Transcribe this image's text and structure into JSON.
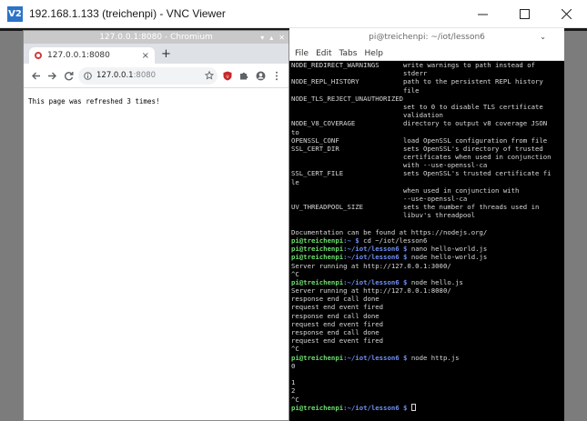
{
  "vnc": {
    "title": "192.168.1.133 (treichenpi) - VNC Viewer",
    "logo_text": "V2"
  },
  "chromium": {
    "window_title": "127.0.0.1:8080 - Chromium",
    "wm_buttons": [
      "▾",
      "▴",
      "✕"
    ],
    "tab_title": "127.0.0.1:8080",
    "tab_close": "×",
    "new_tab": "+",
    "url_host": "127.0.0.1",
    "url_port": ":8080",
    "page_text": "This page was refreshed 3 times!"
  },
  "terminal": {
    "window_title": "pi@treichenpi: ~/iot/lesson6",
    "chevron": "⌄",
    "menu": [
      "File",
      "Edit",
      "Tabs",
      "Help"
    ],
    "lines": [
      {
        "t": "NODE_REDIRECT_WARNINGS      write warnings to path instead of"
      },
      {
        "t": "                            stderr"
      },
      {
        "t": "NODE_REPL_HISTORY           path to the persistent REPL history"
      },
      {
        "t": "                            file"
      },
      {
        "t": "NODE_TLS_REJECT_UNAUTHORIZED"
      },
      {
        "t": "                            set to 0 to disable TLS certificate"
      },
      {
        "t": "                            validation"
      },
      {
        "t": "NODE_V8_COVERAGE            directory to output v8 coverage JSON"
      },
      {
        "t": "to"
      },
      {
        "t": "OPENSSL_CONF                load OpenSSL configuration from file"
      },
      {
        "t": "SSL_CERT_DIR                sets OpenSSL's directory of trusted"
      },
      {
        "t": "                            certificates when used in conjunction"
      },
      {
        "t": "                            with --use-openssl-ca"
      },
      {
        "t": "SSL_CERT_FILE               sets OpenSSL's trusted certificate fi"
      },
      {
        "t": "le"
      },
      {
        "t": "                            when used in conjunction with"
      },
      {
        "t": "                            --use-openssl-ca"
      },
      {
        "t": "UV_THREADPOOL_SIZE          sets the number of threads used in"
      },
      {
        "t": "                            libuv's threadpool"
      },
      {
        "t": ""
      },
      {
        "t": "Documentation can be found at https://nodejs.org/"
      },
      {
        "u": "pi@treichenpi",
        "p": ":~ $",
        "c": " cd ~/iot/lesson6"
      },
      {
        "u": "pi@treichenpi",
        "p": ":~/iot/lesson6 $",
        "c": " nano hello-world.js"
      },
      {
        "u": "pi@treichenpi",
        "p": ":~/iot/lesson6 $",
        "c": " node hello-world.js"
      },
      {
        "t": "Server running at http://127.0.0.1:3000/"
      },
      {
        "t": "^C"
      },
      {
        "u": "pi@treichenpi",
        "p": ":~/iot/lesson6 $",
        "c": " node hello.js"
      },
      {
        "t": "Server running at http://127.0.0.1:8080/"
      },
      {
        "t": "response end call done"
      },
      {
        "t": "request end event fired"
      },
      {
        "t": "response end call done"
      },
      {
        "t": "request end event fired"
      },
      {
        "t": "response end call done"
      },
      {
        "t": "request end event fired"
      },
      {
        "t": "^C"
      },
      {
        "u": "pi@treichenpi",
        "p": ":~/iot/lesson6 $",
        "c": " node http.js"
      },
      {
        "t": "0"
      },
      {
        "t": ""
      },
      {
        "t": "1"
      },
      {
        "t": "2"
      },
      {
        "t": "^C"
      },
      {
        "u": "pi@treichenpi",
        "p": ":~/iot/lesson6 $",
        "c": " ",
        "cursor": true
      }
    ]
  }
}
